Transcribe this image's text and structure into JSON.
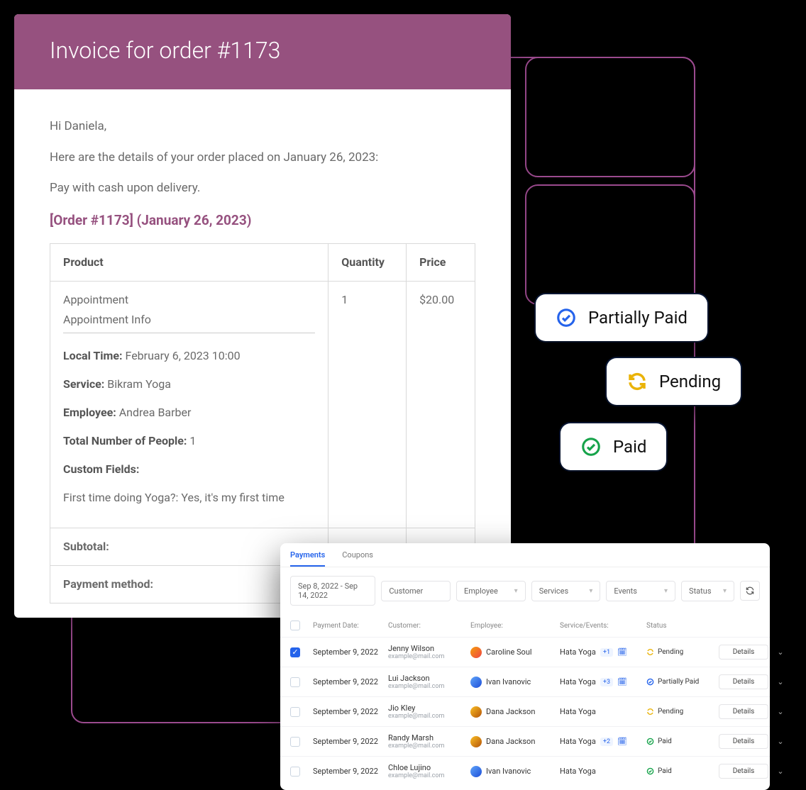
{
  "invoice": {
    "title": "Invoice for order #1173",
    "greeting": "Hi Daniela,",
    "intro": "Here are the details of your order placed on January 26, 2023:",
    "payment_note": "Pay with cash upon delivery.",
    "order_heading": "[Order #1173] (January 26, 2023)",
    "table": {
      "headers": {
        "product": "Product",
        "quantity": "Quantity",
        "price": "Price"
      },
      "row": {
        "product_title": "Appointment",
        "product_subtitle": "Appointment Info",
        "local_time_label": "Local Time:",
        "local_time_value": "February 6, 2023 10:00",
        "service_label": "Service:",
        "service_value": "Bikram Yoga",
        "employee_label": "Employee:",
        "employee_value": "Andrea Barber",
        "people_label": "Total Number of People:",
        "people_value": "1",
        "custom_fields_label": "Custom Fields:",
        "cf_q1_label": "First time doing Yoga?:",
        "cf_q1_value": "Yes, it's my first time",
        "quantity": "1",
        "price": "$20.00"
      },
      "subtotal_label": "Subtotal:",
      "payment_method_label": "Payment method:"
    }
  },
  "pills": {
    "partial": "Partially Paid",
    "pending": "Pending",
    "paid": "Paid"
  },
  "payments": {
    "tabs": {
      "payments": "Payments",
      "coupons": "Coupons"
    },
    "filters": {
      "date_range": "Sep 8, 2022 - Sep 14, 2022",
      "customer": "Customer",
      "employee": "Employee",
      "services": "Services",
      "events": "Events",
      "status": "Status"
    },
    "headers": {
      "date": "Payment Date:",
      "customer": "Customer:",
      "employee": "Employee:",
      "service": "Service/Events:",
      "status": "Status"
    },
    "details_label": "Details",
    "rows": [
      {
        "checked": true,
        "date": "September 9, 2022",
        "customer": "Jenny Wilson",
        "email": "example@mail.com",
        "employee": "Caroline Soul",
        "avatar": "a",
        "service": "Hata Yoga",
        "badge": "+1",
        "cal": true,
        "status": "Pending",
        "status_kind": "pending"
      },
      {
        "checked": false,
        "date": "September 9, 2022",
        "customer": "Lui Jackson",
        "email": "example@mail.com",
        "employee": "Ivan Ivanovic",
        "avatar": "b",
        "service": "Hata Yoga",
        "badge": "+3",
        "cal": true,
        "status": "Partially Paid",
        "status_kind": "partial"
      },
      {
        "checked": false,
        "date": "September 9, 2022",
        "customer": "Jio Kley",
        "email": "example@mail.com",
        "employee": "Dana Jackson",
        "avatar": "c",
        "service": "Hata Yoga",
        "badge": "",
        "cal": false,
        "status": "Pending",
        "status_kind": "pending"
      },
      {
        "checked": false,
        "date": "September 9, 2022",
        "customer": "Randy Marsh",
        "email": "example@mail.com",
        "employee": "Dana Jackson",
        "avatar": "c",
        "service": "Hata Yoga",
        "badge": "+2",
        "cal": true,
        "status": "Paid",
        "status_kind": "paid"
      },
      {
        "checked": false,
        "date": "September 9, 2022",
        "customer": "Chloe Lujino",
        "email": "example@mail.com",
        "employee": "Ivan Ivanovic",
        "avatar": "b",
        "service": "Hata Yoga",
        "badge": "",
        "cal": false,
        "status": "Paid",
        "status_kind": "paid"
      }
    ]
  }
}
